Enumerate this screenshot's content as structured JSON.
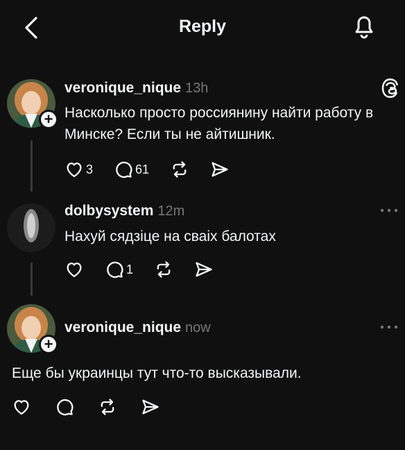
{
  "header": {
    "title": "Reply",
    "back_icon": "chevron-left-icon",
    "bell_icon": "bell-icon"
  },
  "posts": [
    {
      "username": "veronique_nique",
      "time": "13h",
      "text": "Насколько просто россиянину найти работу в Минске? Если ты не айтишник.",
      "likes": "3",
      "replies": "61"
    },
    {
      "username": "dolbysystem",
      "time": "12m",
      "text": "Нахуй сядзіце на сваіх балотах",
      "likes": "",
      "replies": "1"
    },
    {
      "username": "veronique_nique",
      "time": "now",
      "text": "Еще бы украинцы тут что-то высказывали.",
      "likes": "",
      "replies": ""
    }
  ],
  "colors": {
    "background": "#101010",
    "text": "#f3f5f7",
    "muted": "#777777",
    "thread_line": "#3a3a3a"
  }
}
